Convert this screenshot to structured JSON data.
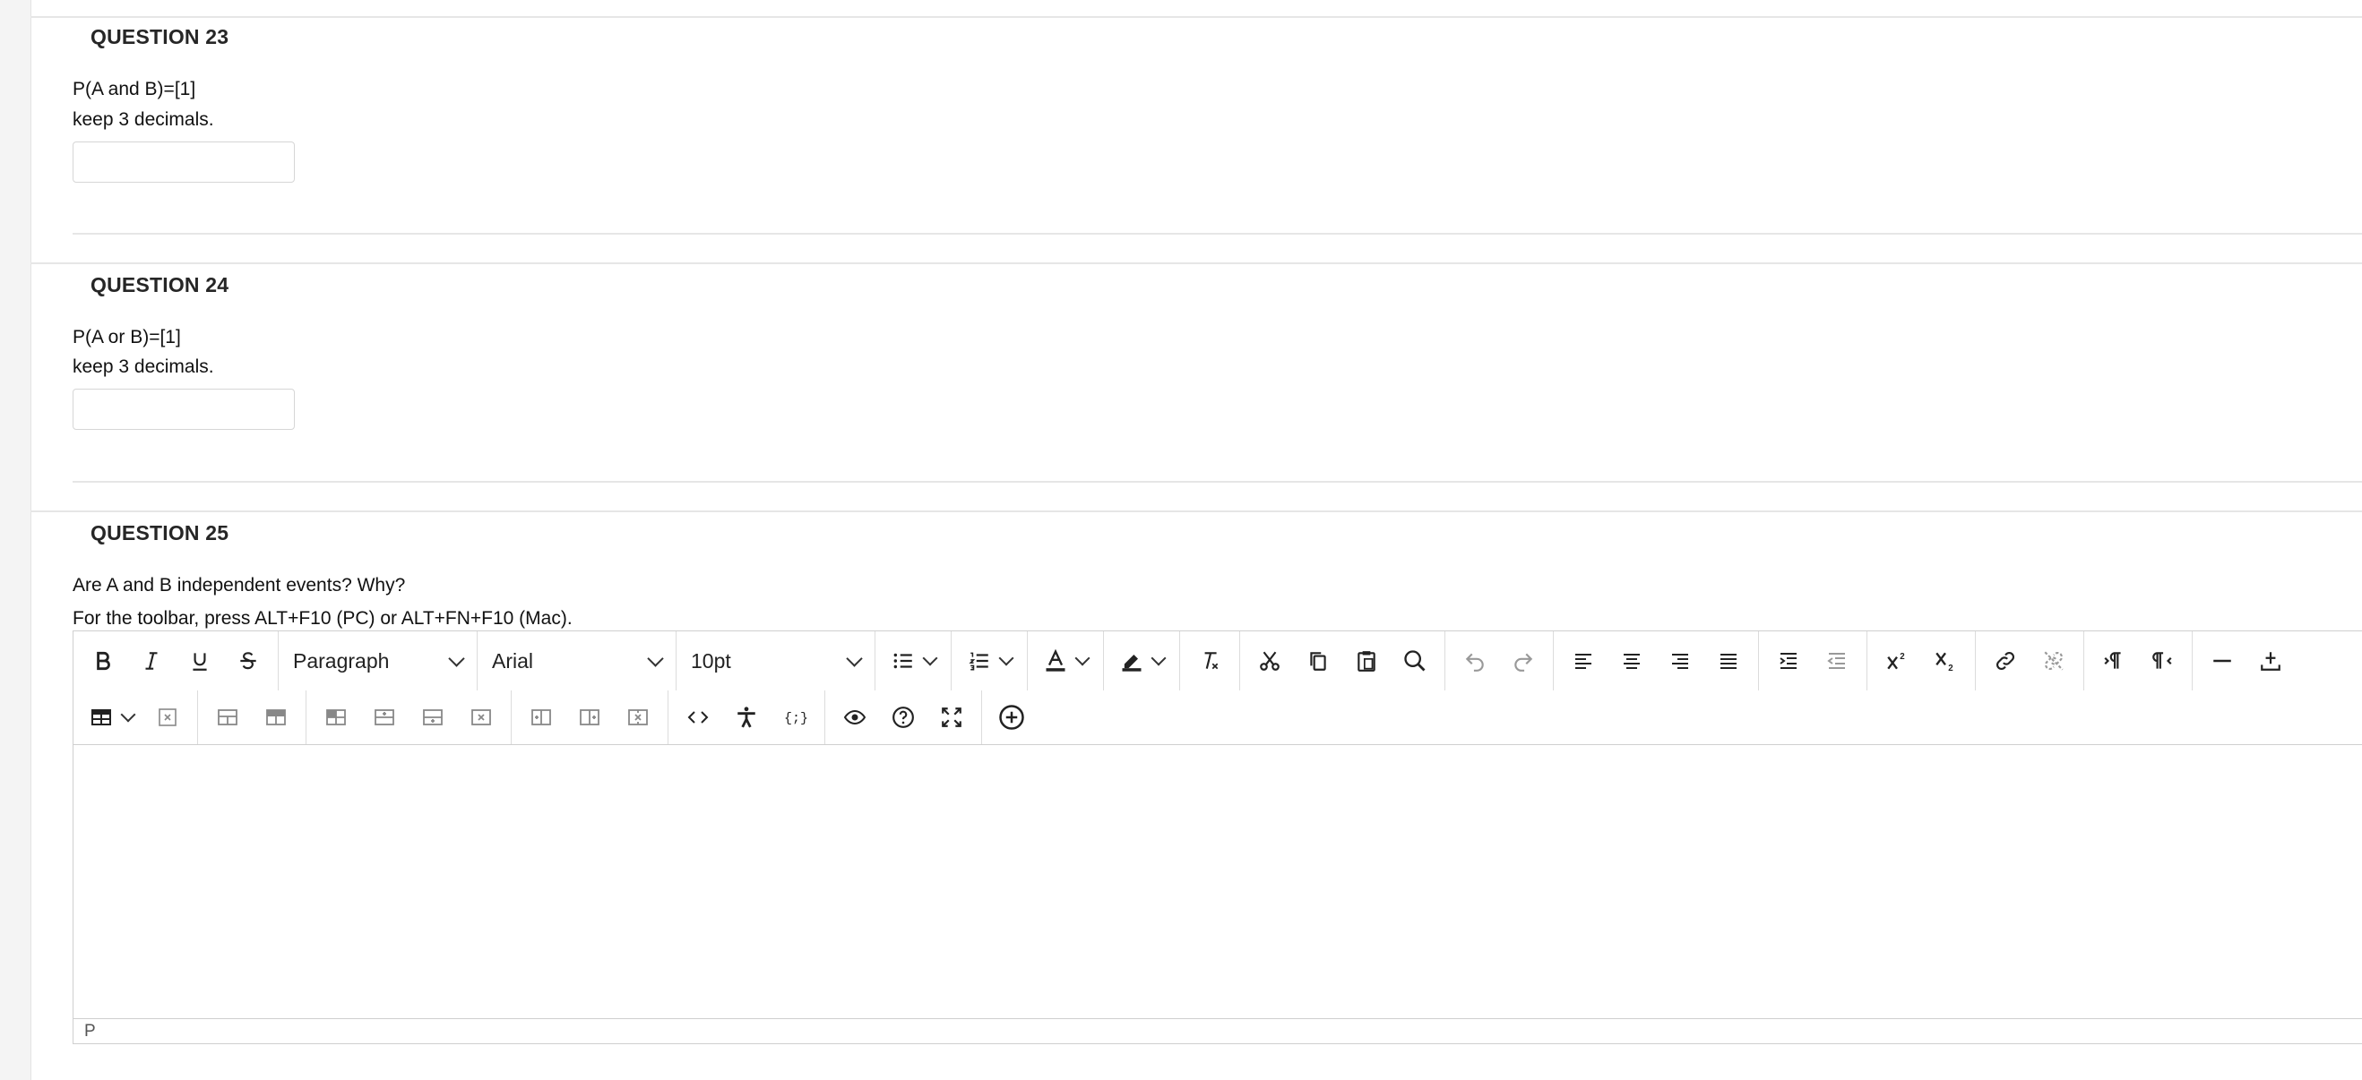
{
  "questions": [
    {
      "title": "QUESTION 23",
      "lines": [
        "P(A and B)=[1]",
        "keep 3 decimals."
      ]
    },
    {
      "title": "QUESTION 24",
      "lines": [
        "P(A or B)=[1]",
        "keep 3 decimals."
      ]
    },
    {
      "title": "QUESTION 25",
      "lines": [
        "Are A and B independent events? Why?",
        "For the toolbar, press ALT+F10 (PC) or ALT+FN+F10 (Mac)."
      ]
    }
  ],
  "editor": {
    "block_format": "Paragraph",
    "font_family": "Arial",
    "font_size": "10pt",
    "status_path": "P",
    "toolbar_row1": [
      "bold-icon",
      "italic-icon",
      "underline-icon",
      "strikethrough-icon",
      "bullet-list-icon",
      "numbered-list-icon",
      "text-color-icon",
      "highlight-icon",
      "clear-formatting-icon",
      "cut-icon",
      "copy-icon",
      "paste-icon",
      "search-icon",
      "undo-icon",
      "redo-icon",
      "align-left-icon",
      "align-center-icon",
      "align-right-icon",
      "justify-icon",
      "indent-icon",
      "outdent-icon",
      "superscript-icon",
      "subscript-icon",
      "link-icon",
      "unlink-icon",
      "ltr-icon",
      "rtl-icon",
      "horizontal-line-icon",
      "insert-icon"
    ],
    "toolbar_row2": [
      "table-icon",
      "delete-table-icon",
      "table-row-props-icon",
      "table-cell-props-icon",
      "table-merge-icon",
      "insert-row-before-icon",
      "insert-row-after-icon",
      "delete-row-icon",
      "insert-col-before-icon",
      "insert-col-after-icon",
      "delete-col-icon",
      "code-icon",
      "accessibility-icon",
      "template-icon",
      "preview-icon",
      "help-icon",
      "fullscreen-icon",
      "add-content-icon"
    ]
  }
}
